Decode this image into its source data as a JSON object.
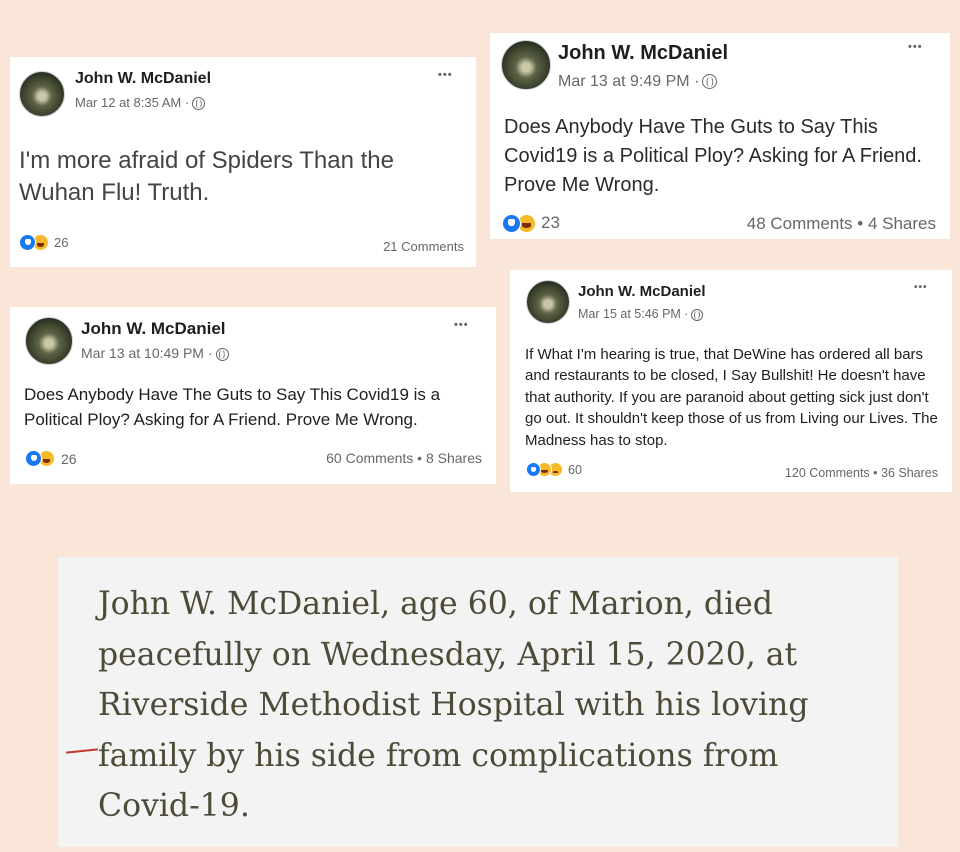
{
  "posts": [
    {
      "author": "John W. McDaniel",
      "timestamp": "Mar 12 at 8:35 AM ·",
      "menu": "•••",
      "text": "I'm more afraid of Spiders Than the Wuhan Flu! Truth.",
      "reaction_count": "26",
      "stats": "21 Comments",
      "reactions": [
        "like",
        "haha"
      ]
    },
    {
      "author": "John W. McDaniel",
      "timestamp": "Mar 13 at 9:49 PM ·",
      "menu": "•••",
      "text": "Does Anybody Have The Guts to Say This Covid19 is a Political Ploy? Asking for A Friend. Prove Me Wrong.",
      "reaction_count": "23",
      "stats": "48 Comments • 4 Shares",
      "reactions": [
        "like",
        "haha"
      ]
    },
    {
      "author": "John W. McDaniel",
      "timestamp": "Mar 13 at 10:49 PM ·",
      "menu": "•••",
      "text": "Does Anybody Have The Guts to Say This Covid19 is a Political Ploy? Asking for A Friend. Prove Me Wrong.",
      "reaction_count": "26",
      "stats": "60 Comments • 8 Shares",
      "reactions": [
        "like",
        "haha"
      ]
    },
    {
      "author": "John W. McDaniel",
      "timestamp": "Mar 15 at 5:46 PM ·",
      "menu": "•••",
      "text": "If What I'm hearing is true, that DeWine has ordered all bars and restaurants to be closed, I Say Bullshit! He doesn't have that authority. If you are paranoid about getting sick just don't go out. It shouldn't keep those of us from Living our Lives. The Madness has to stop.",
      "reaction_count": "60",
      "stats": "120 Comments • 36 Shares",
      "reactions": [
        "like",
        "haha",
        "sad"
      ]
    }
  ],
  "obituary": {
    "text": "John W. McDaniel, age 60, of Marion, died peacefully on Wednesday, April 15, 2020, at Riverside Methodist Hospital with his loving family by his side from complications from Covid-19."
  },
  "colors": {
    "background": "#f9e6d8",
    "like_blue": "#1877f2",
    "haha_yellow": "#f7b928",
    "obituary_text": "#4d4a38"
  },
  "icons": [
    "globe-icon",
    "more-options-icon",
    "like-reaction-icon",
    "haha-reaction-icon",
    "sad-reaction-icon"
  ]
}
